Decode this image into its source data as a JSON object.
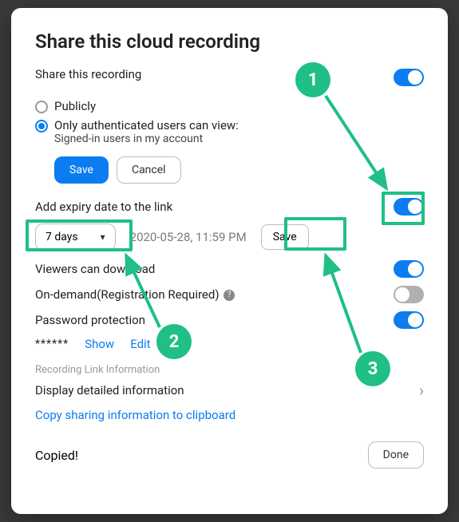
{
  "title": "Share this cloud recording",
  "share_section_label": "Share this recording",
  "radio_public": "Publicly",
  "radio_auth": "Only authenticated users can view:",
  "radio_auth_sub": "Signed-in users in my account",
  "save_label": "Save",
  "cancel_label": "Cancel",
  "expiry_label": "Add expiry date to the link",
  "expiry_select": "7 days",
  "expiry_date": "2020-05-28, 11:59 PM",
  "expiry_save": "Save",
  "viewers_download": "Viewers can download",
  "on_demand": "On-demand(Registration Required)",
  "password_protection": "Password protection",
  "password_mask": "******",
  "show_label": "Show",
  "edit_label": "Edit",
  "rec_link_info": "Recording Link Information",
  "display_detailed": "Display detailed information",
  "copy_info": "Copy sharing information to clipboard",
  "copied": "Copied!",
  "done": "Done",
  "annotations": {
    "n1": "1",
    "n2": "2",
    "n3": "3"
  }
}
